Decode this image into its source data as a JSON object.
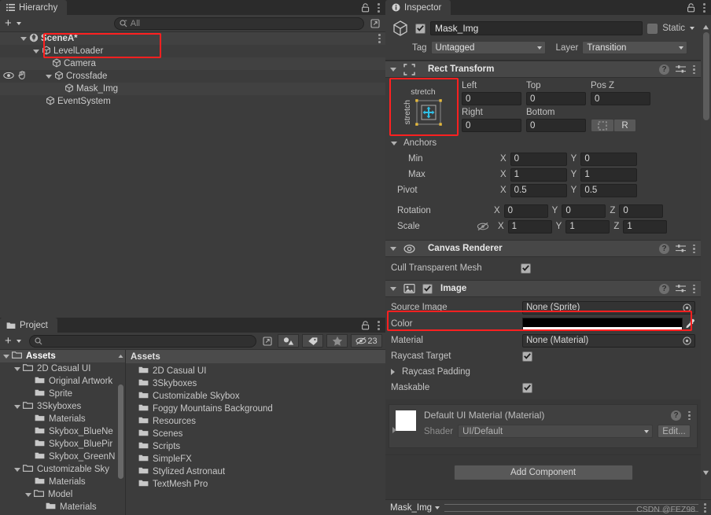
{
  "hierarchy": {
    "tab_label": "Hierarchy",
    "search_placeholder": "All",
    "search_value": "",
    "rows": [
      {
        "label": "SceneA*",
        "depth": 0,
        "icon": "scene-icon",
        "expanded": true,
        "has_kebab": true
      },
      {
        "label": "LevelLoader",
        "depth": 1,
        "icon": "gameobject-icon",
        "expanded": true
      },
      {
        "label": "Camera",
        "depth": 2,
        "icon": "gameobject-icon",
        "expanded": false
      },
      {
        "label": "Crossfade",
        "depth": 2,
        "icon": "gameobject-icon",
        "expanded": true,
        "visibility_icons": true
      },
      {
        "label": "Mask_Img",
        "depth": 3,
        "icon": "gameobject-icon",
        "expanded": false
      },
      {
        "label": "EventSystem",
        "depth": 1,
        "icon": "gameobject-icon",
        "expanded": false
      }
    ]
  },
  "project": {
    "tab_label": "Project",
    "search_placeholder": "",
    "search_value": "",
    "hidden_count": "23",
    "list_header": "Assets",
    "tree": [
      {
        "label": "Assets",
        "depth": 0,
        "expanded": true,
        "selected": true,
        "open_folder": true
      },
      {
        "label": "2D Casual UI",
        "depth": 1,
        "expanded": true,
        "open_folder": true
      },
      {
        "label": "Original Artwork",
        "depth": 2,
        "expanded": false
      },
      {
        "label": "Sprite",
        "depth": 2,
        "expanded": false
      },
      {
        "label": "3Skyboxes",
        "depth": 1,
        "expanded": true,
        "open_folder": true
      },
      {
        "label": "Materials",
        "depth": 2,
        "expanded": false
      },
      {
        "label": "Skybox_BlueNe",
        "depth": 2,
        "expanded": false
      },
      {
        "label": "Skybox_BluePir",
        "depth": 2,
        "expanded": false
      },
      {
        "label": "Skybox_GreenN",
        "depth": 2,
        "expanded": false
      },
      {
        "label": "Customizable Sky",
        "depth": 1,
        "expanded": true,
        "open_folder": true
      },
      {
        "label": "Materials",
        "depth": 2,
        "expanded": false
      },
      {
        "label": "Model",
        "depth": 2,
        "expanded": true,
        "open_folder": true
      },
      {
        "label": "Materials",
        "depth": 3,
        "expanded": false
      }
    ],
    "items": [
      {
        "label": "2D Casual UI"
      },
      {
        "label": "3Skyboxes"
      },
      {
        "label": "Customizable Skybox"
      },
      {
        "label": "Foggy Mountains Background"
      },
      {
        "label": "Resources"
      },
      {
        "label": "Scenes"
      },
      {
        "label": "Scripts"
      },
      {
        "label": "SimpleFX"
      },
      {
        "label": "Stylized Astronaut"
      },
      {
        "label": "TextMesh Pro"
      }
    ]
  },
  "inspector": {
    "tab_label": "Inspector",
    "game_object": {
      "name": "Mask_Img",
      "enabled": true,
      "static_label": "Static",
      "static_checked": false,
      "tag_label": "Tag",
      "tag_value": "Untagged",
      "layer_label": "Layer",
      "layer_value": "Transition"
    },
    "rect_transform": {
      "title": "Rect Transform",
      "anchor_preset_top": "stretch",
      "anchor_preset_left": "stretch",
      "left_label": "Left",
      "left_value": "0",
      "top_label": "Top",
      "top_value": "0",
      "posz_label": "Pos Z",
      "posz_value": "0",
      "right_label": "Right",
      "right_value": "0",
      "bottom_label": "Bottom",
      "bottom_value": "0",
      "blueprint_btn": "blueprint-mode-icon",
      "raw_btn": "R",
      "anchors_label": "Anchors",
      "min_label": "Min",
      "min_x": "0",
      "min_y": "0",
      "max_label": "Max",
      "max_x": "1",
      "max_y": "1",
      "pivot_label": "Pivot",
      "pivot_x": "0.5",
      "pivot_y": "0.5",
      "rotation_label": "Rotation",
      "rot_x": "0",
      "rot_y": "0",
      "rot_z": "0",
      "scale_label": "Scale",
      "scale_x": "1",
      "scale_y": "1",
      "scale_z": "1",
      "axis_x": "X",
      "axis_y": "Y",
      "axis_z": "Z"
    },
    "canvas_renderer": {
      "title": "Canvas Renderer",
      "cull_label": "Cull Transparent Mesh",
      "cull_checked": true
    },
    "image": {
      "title": "Image",
      "enabled": true,
      "source_image_label": "Source Image",
      "source_image_value": "None (Sprite)",
      "color_label": "Color",
      "color_value": "#000000",
      "color_alpha_bar": "#ffffff",
      "material_label": "Material",
      "material_value": "None (Material)",
      "raycast_target_label": "Raycast Target",
      "raycast_target_checked": true,
      "raycast_padding_label": "Raycast Padding",
      "maskable_label": "Maskable",
      "maskable_checked": true
    },
    "material_panel": {
      "title": "Default UI Material (Material)",
      "shader_label": "Shader",
      "shader_value": "UI/Default",
      "edit_label": "Edit...",
      "swatch_color": "#ffffff"
    },
    "add_component_label": "Add Component",
    "footer_dropdown": "Mask_Img",
    "watermark": "CSDN @FEZ98"
  },
  "theme": {
    "highlight": "#ff2020",
    "panel_bg": "#383838",
    "body_bg": "#3c3c3c",
    "header_bg": "#474747",
    "anchor_handle": "#e5b93c",
    "anchor_arrow": "#2fc1e8"
  }
}
